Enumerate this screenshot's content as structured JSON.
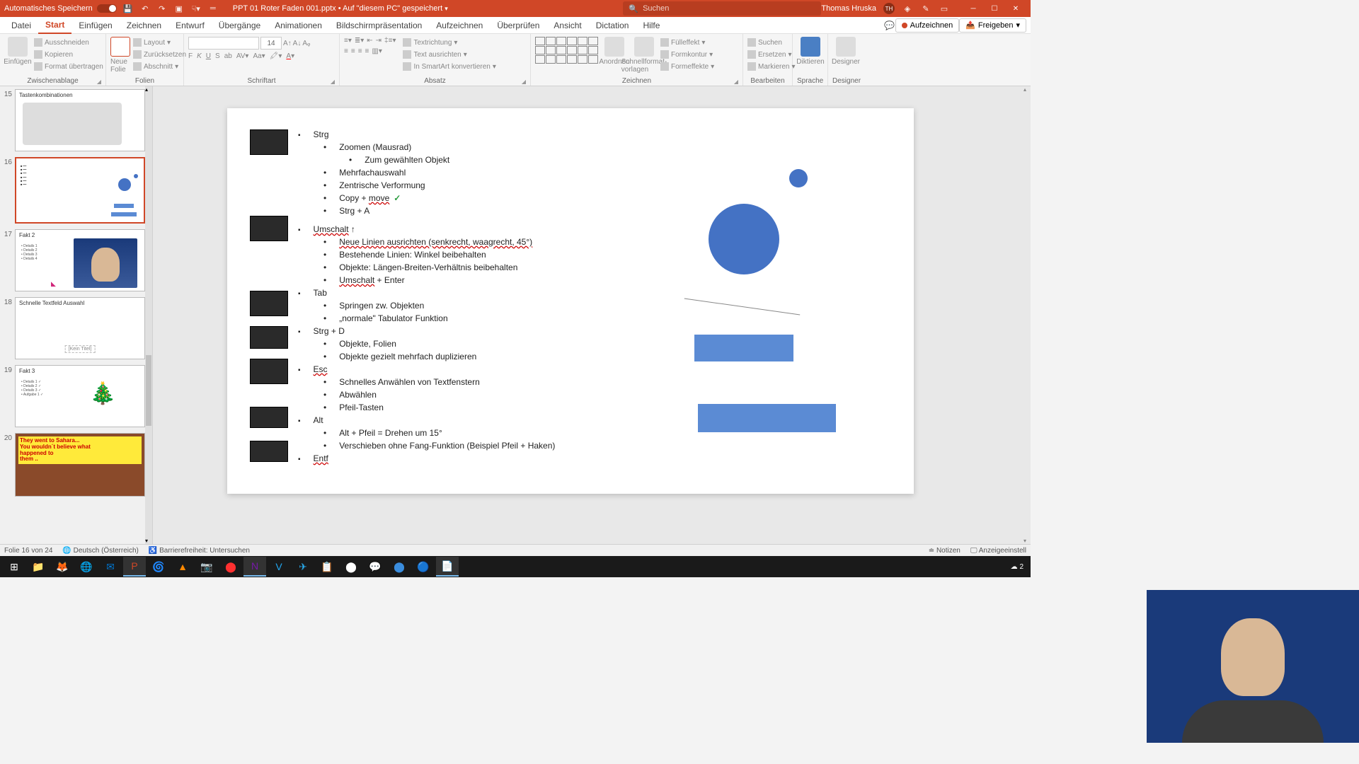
{
  "titlebar": {
    "autosave": "Automatisches Speichern",
    "filename": "PPT 01 Roter Faden 001.pptx • Auf \"diesem PC\" gespeichert",
    "search_placeholder": "Suchen",
    "username": "Thomas Hruska",
    "user_initials": "TH"
  },
  "menu": {
    "items": [
      "Datei",
      "Start",
      "Einfügen",
      "Zeichnen",
      "Entwurf",
      "Übergänge",
      "Animationen",
      "Bildschirmpräsentation",
      "Aufzeichnen",
      "Überprüfen",
      "Ansicht",
      "Dictation",
      "Hilfe"
    ],
    "active_index": 1,
    "record": "Aufzeichnen",
    "share": "Freigeben"
  },
  "ribbon": {
    "clipboard": {
      "label": "Zwischenablage",
      "paste": "Einfügen",
      "cut": "Ausschneiden",
      "copy": "Kopieren",
      "format": "Format übertragen"
    },
    "slides": {
      "label": "Folien",
      "new": "Neue Folie",
      "layout": "Layout",
      "reset": "Zurücksetzen",
      "section": "Abschnitt"
    },
    "font": {
      "label": "Schriftart",
      "size": "14"
    },
    "paragraph": {
      "label": "Absatz",
      "textdir": "Textrichtung",
      "align": "Text ausrichten",
      "smartart": "In SmartArt konvertieren"
    },
    "drawing": {
      "label": "Zeichnen",
      "arrange": "Anordnen",
      "quick": "Schnellformat-vorlagen",
      "fill": "Fülleffekt",
      "outline": "Formkontur",
      "effects": "Formeffekte"
    },
    "editing": {
      "label": "Bearbeiten",
      "find": "Suchen",
      "replace": "Ersetzen",
      "select": "Markieren"
    },
    "voice": {
      "label": "Sprache",
      "dictate": "Diktieren"
    },
    "designer": {
      "label": "Designer",
      "btn": "Designer"
    }
  },
  "thumbnails": [
    {
      "num": "15",
      "title": "Tastenkombinationen"
    },
    {
      "num": "16",
      "title": ""
    },
    {
      "num": "17",
      "title": "Fakt 2"
    },
    {
      "num": "18",
      "title": "Schnelle Textfeld Auswahl",
      "subtitle": "[Kein Titel]"
    },
    {
      "num": "19",
      "title": "Fakt 3"
    },
    {
      "num": "20",
      "title": ""
    }
  ],
  "slide": {
    "strg": {
      "h": "Strg",
      "b1": "Zoomen (Mausrad)",
      "b1a": "Zum gewählten Objekt",
      "b2": "Mehrfachauswahl",
      "b3": "Zentrische Verformung",
      "b4": "Copy + ",
      "b4u": "move",
      "b5": "Strg + A"
    },
    "umschalt": {
      "h": "Umschalt",
      "arrow": "↑",
      "b1": "Neue Linien ausrichten (senkrecht, waagrecht, 45°)",
      "b2": "Bestehende Linien: Winkel beibehalten",
      "b3": "Objekte: Längen-Breiten-Verhältnis beibehalten",
      "b4": "Umschalt",
      "b4s": " + Enter"
    },
    "tab": {
      "h": "Tab",
      "b1": "Springen zw. Objekten",
      "b2": "„normale\" Tabulator Funktion"
    },
    "strgd": {
      "h": "Strg + D",
      "b1": "Objekte, Folien",
      "b2": "Objekte gezielt mehrfach duplizieren"
    },
    "esc": {
      "h": "Esc",
      "b1": "Schnelles Anwählen von Textfenstern",
      "b2": "Abwählen",
      "b3": "Pfeil-Tasten"
    },
    "alt": {
      "h": "Alt",
      "b1": "Alt + Pfeil = Drehen um 15°",
      "b2": "Verschieben ohne Fang-Funktion (Beispiel Pfeil + Haken)"
    },
    "entf": {
      "h": "Entf"
    }
  },
  "status": {
    "slide_info": "Folie 16 von 24",
    "language": "Deutsch (Österreich)",
    "accessibility": "Barrierefreiheit: Untersuchen",
    "notes": "Notizen",
    "display": "Anzeigeeinstell"
  },
  "taskbar": {
    "temp": "2"
  }
}
